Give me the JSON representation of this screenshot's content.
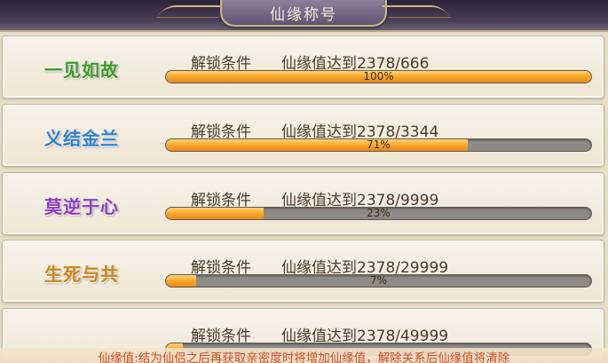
{
  "header": {
    "title": "仙缘称号"
  },
  "titles": [
    {
      "name": "一见如故",
      "label": "解锁条件",
      "condition": "仙缘值达到2378/666",
      "percent": 100,
      "percent_text": "100%",
      "color": "#3f9b2a"
    },
    {
      "name": "义结金兰",
      "label": "解锁条件",
      "condition": "仙缘值达到2378/3344",
      "percent": 71,
      "percent_text": "71%",
      "color": "#2f7fd0"
    },
    {
      "name": "莫逆于心",
      "label": "解锁条件",
      "condition": "仙缘值达到2378/9999",
      "percent": 23,
      "percent_text": "23%",
      "color": "#8a3fc2"
    },
    {
      "name": "生死与共",
      "label": "解锁条件",
      "condition": "仙缘值达到2378/29999",
      "percent": 7,
      "percent_text": "7%",
      "color": "#c7861a"
    },
    {
      "name": "",
      "label": "解锁条件",
      "condition": "仙缘值达到2378/49999",
      "percent": 4,
      "percent_text": "",
      "color": "#c23b2f"
    }
  ],
  "footer": {
    "note": "仙缘值:结为仙侣之后再获取亲密度时将增加仙缘值，解除关系后仙缘值将清除"
  }
}
